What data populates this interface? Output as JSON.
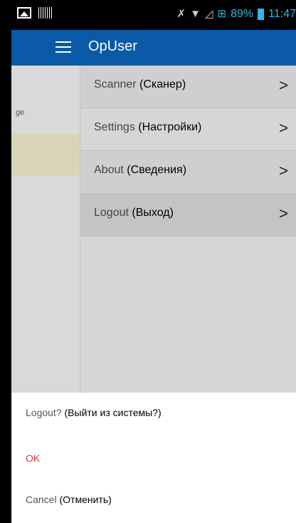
{
  "status_bar": {
    "battery": "89%",
    "time": "11:47"
  },
  "app_bar": {
    "title": "OpUser"
  },
  "background": {
    "partial_text": "ge"
  },
  "drawer": {
    "items": [
      {
        "label": "Scanner",
        "translation": "(Сканер)",
        "chevron": ">"
      },
      {
        "label": "Settings",
        "translation": "(Настройки)",
        "chevron": ">"
      },
      {
        "label": "About",
        "translation": "(Сведения)",
        "chevron": ">"
      },
      {
        "label": "Logout",
        "translation": "(Выход)",
        "chevron": ">"
      }
    ]
  },
  "dialog": {
    "title": "Logout?",
    "title_translation": "(Выйти из системы?)",
    "ok_label": "OK",
    "cancel_label": "Cancel",
    "cancel_translation": "(Отменить)"
  },
  "colors": {
    "app_bar": "#0a5aa8",
    "status_accent": "#33b5e5",
    "ok_red": "#e53935"
  }
}
